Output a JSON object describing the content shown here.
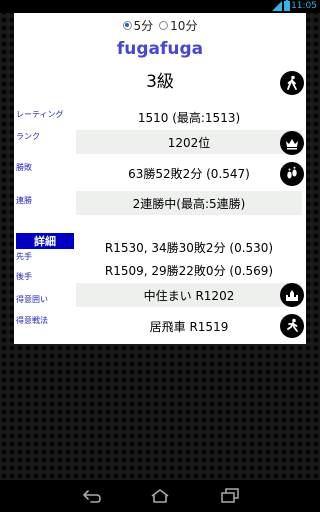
{
  "status": {
    "time": "11:05"
  },
  "modes": [
    {
      "label": "5分",
      "checked": true
    },
    {
      "label": "10分",
      "checked": false
    }
  ],
  "player": {
    "name": "fugafuga",
    "rank": "3級"
  },
  "labels": {
    "rating": "レーティング",
    "rank": "ランク",
    "record": "勝敗",
    "streak": "連勝",
    "detail": "詳細",
    "sente": "先手",
    "gote": "後手",
    "fav_castle": "得意囲い",
    "fav_strategy": "得意戦法"
  },
  "values": {
    "rating": "1510 (最高:1513)",
    "rank": "1202位",
    "record": "63勝52敗2分 (0.547)",
    "streak": "2連勝中(最高:5連勝)",
    "sente": "R1530, 34勝30敗2分 (0.530)",
    "gote": "R1509, 29勝22敗0分 (0.569)",
    "fav_castle": "中住まい R1202",
    "fav_strategy": "居飛車 R1519"
  },
  "icons": {
    "walker": "walking-person-icon",
    "crown": "crown-icon",
    "footprints": "footprints-icon",
    "castle": "castle-icon",
    "runner": "runner-icon"
  }
}
